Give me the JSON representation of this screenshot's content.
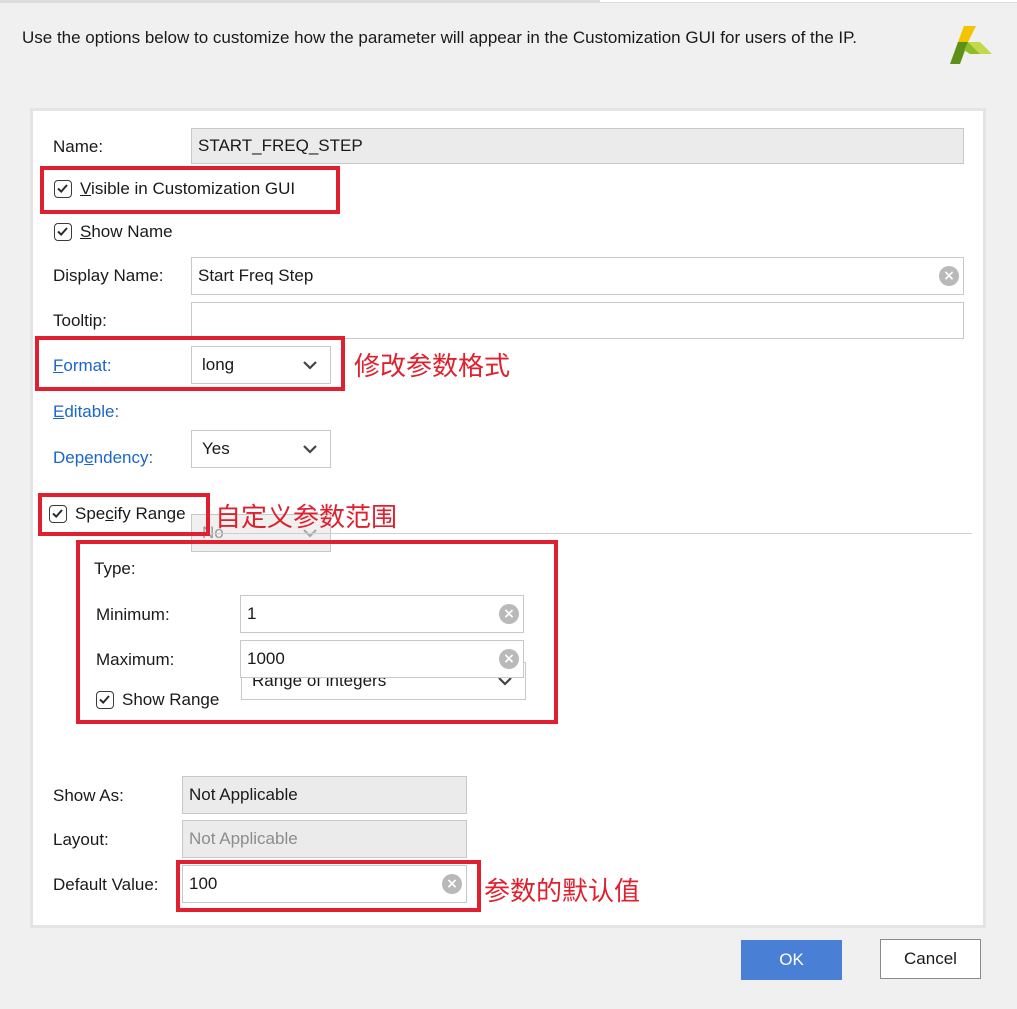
{
  "intro_text": "Use the options below to customize how the parameter will appear in the Customization GUI for users of the IP.",
  "form": {
    "name_label": "Name:",
    "name_value": "START_FREQ_STEP",
    "visible_label_u": "V",
    "visible_label_rest": "isible in Customization GUI",
    "show_name_u": "S",
    "show_name_rest": "how Name",
    "display_name_label": "Display Name:",
    "display_name_value": "Start Freq Step",
    "tooltip_label": "Tooltip:",
    "tooltip_value": "",
    "format_label_u": "F",
    "format_label_rest": "ormat:",
    "format_value": "long",
    "editable_label_u": "E",
    "editable_label_rest": "ditable:",
    "editable_value": "Yes",
    "dependency_label_pre": "Dep",
    "dependency_label_u": "e",
    "dependency_label_rest": "ndency:",
    "dependency_value": "No",
    "specify_range_pre": "Spe",
    "specify_range_u": "c",
    "specify_range_rest": "ify Range",
    "range": {
      "type_label": "Type:",
      "type_value": "Range of integers",
      "minimum_label": "Minimum:",
      "minimum_value": "1",
      "maximum_label": "Maximum:",
      "maximum_value": "1000",
      "show_range_label": "Show Range"
    },
    "show_as_label": "Show As:",
    "show_as_value": "Not Applicable",
    "layout_label": "Layout:",
    "layout_value": "Not Applicable",
    "default_value_label": "Default Value:",
    "default_value": "100"
  },
  "annotations": {
    "format_note": "修改参数格式",
    "range_note": "自定义参数范围",
    "default_note": "参数的默认值"
  },
  "buttons": {
    "ok": "OK",
    "cancel": "Cancel"
  },
  "checkboxes": {
    "visible_checked": true,
    "show_name_checked": true,
    "specify_range_checked": true,
    "show_range_checked": true
  },
  "colors": {
    "annotation_red": "#e0202e",
    "link_blue": "#1a66c9",
    "ok_blue": "#4a7fd6",
    "logo_green": "#7ab800"
  }
}
